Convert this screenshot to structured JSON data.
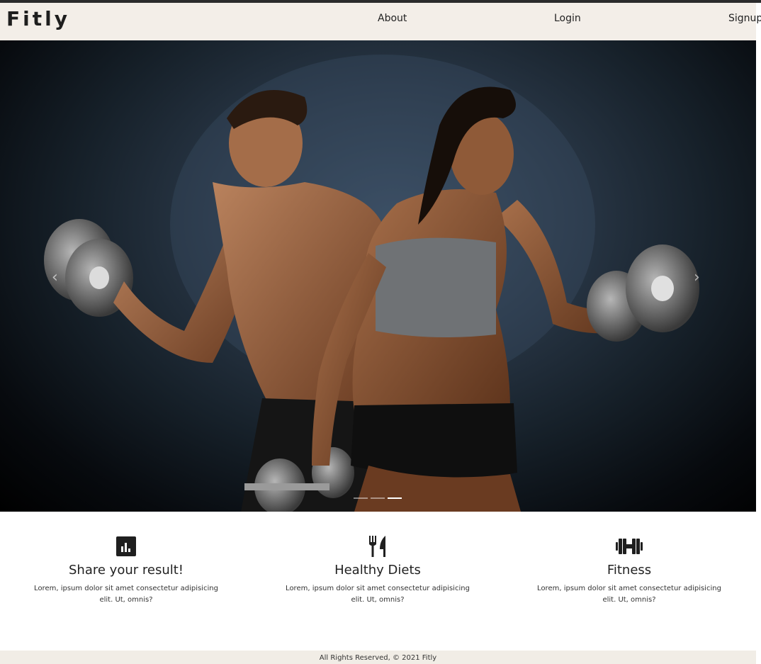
{
  "brand": {
    "logo_text": "Fitly"
  },
  "nav": {
    "about": "About",
    "login": "Login",
    "signup": "Signup"
  },
  "carousel": {
    "prev_icon": "chevron-left-icon",
    "next_icon": "chevron-right-icon",
    "slide_count": 3,
    "active_index": 2
  },
  "features": [
    {
      "icon": "bar-chart-icon",
      "title": "Share your result!",
      "text": "Lorem, ipsum dolor sit amet consectetur adipisicing elit. Ut, omnis?"
    },
    {
      "icon": "utensils-icon",
      "title": "Healthy Diets",
      "text": "Lorem, ipsum dolor sit amet consectetur adipisicing elit. Ut, omnis?"
    },
    {
      "icon": "dumbbell-icon",
      "title": "Fitness",
      "text": "Lorem, ipsum dolor sit amet consectetur adipisicing elit. Ut, omnis?"
    }
  ],
  "footer": {
    "text": "All Rights Reserved, © 2021 Fitly"
  },
  "colors": {
    "navbar_bg": "#f3eee8",
    "footer_bg": "#f1ede6",
    "hero_bg": "#1a2530",
    "text": "#222222"
  }
}
